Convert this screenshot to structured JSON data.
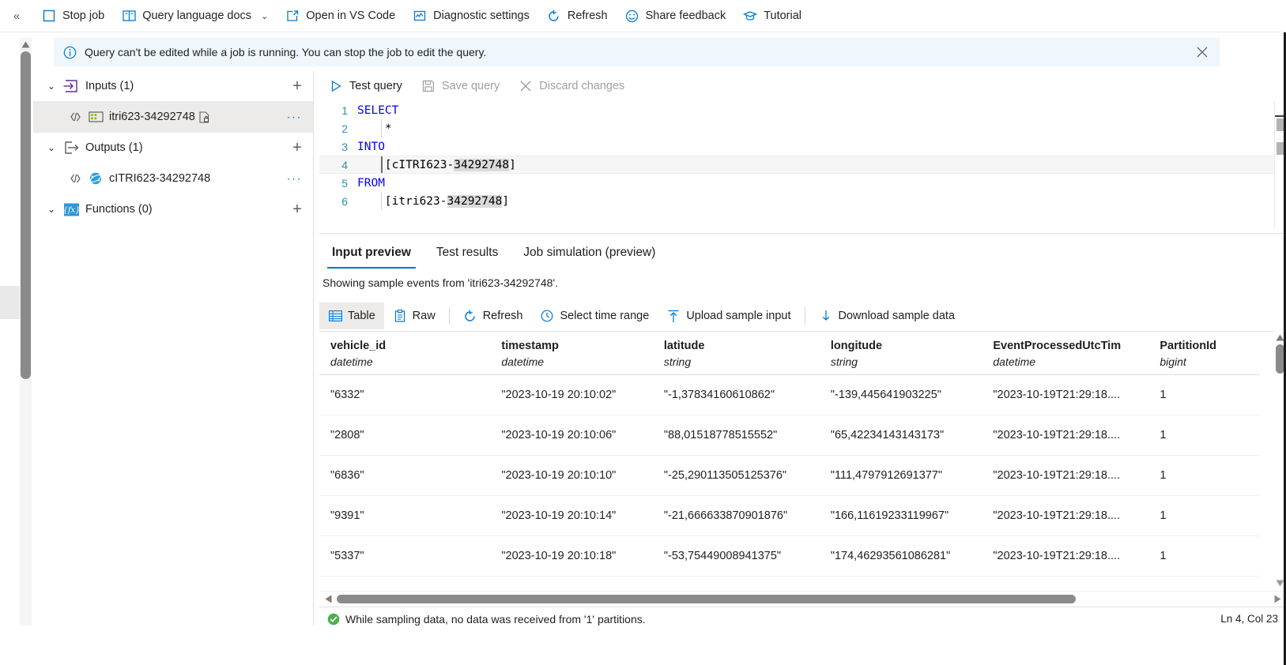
{
  "commandbar": {
    "collapse_glyph": "«",
    "items": [
      {
        "label": "Stop job",
        "icon": "stop-square-icon",
        "has_chevron": false
      },
      {
        "label": "Query language docs",
        "icon": "book-icon",
        "has_chevron": true,
        "chevron": "⌄"
      },
      {
        "label": "Open in VS Code",
        "icon": "open-external-icon",
        "has_chevron": false
      },
      {
        "label": "Diagnostic settings",
        "icon": "chart-monitor-icon",
        "has_chevron": false
      },
      {
        "label": "Refresh",
        "icon": "refresh-icon",
        "has_chevron": false
      },
      {
        "label": "Share feedback",
        "icon": "smiley-icon",
        "has_chevron": false
      },
      {
        "label": "Tutorial",
        "icon": "graduation-cap-icon",
        "has_chevron": false
      }
    ]
  },
  "banner": {
    "icon": "info-circle-icon",
    "message": "Query can't be edited while a job is running. You can stop the job to edit the query.",
    "close_icon": "close-icon"
  },
  "tree": {
    "groups": [
      {
        "label": "Inputs (1)",
        "icon": "input-arrow-icon",
        "chevron": "⌄",
        "add_glyph": "+",
        "children": [
          {
            "label": "itri623-34292748",
            "icon": "event-hub-icon",
            "link_icon": "link-icon",
            "doc_icon": "document-lock-icon",
            "more_glyph": "···",
            "selected": true
          }
        ]
      },
      {
        "label": "Outputs (1)",
        "icon": "output-arrow-icon",
        "chevron": "⌄",
        "add_glyph": "+",
        "children": [
          {
            "label": "cITRI623-34292748",
            "icon": "cosmos-db-icon",
            "link_icon": "link-icon",
            "doc_icon": "",
            "more_glyph": "···",
            "selected": false
          }
        ]
      },
      {
        "label": "Functions (0)",
        "icon": "function-icon",
        "chevron": "⌄",
        "add_glyph": "+",
        "children": []
      }
    ]
  },
  "editor": {
    "toolbar": [
      {
        "label": "Test query",
        "icon": "play-icon",
        "disabled": false
      },
      {
        "label": "Save query",
        "icon": "save-icon",
        "disabled": true
      },
      {
        "label": "Discard changes",
        "icon": "close-x-icon",
        "disabled": true
      }
    ],
    "lines": [
      {
        "no": "1",
        "keyword": "SELECT",
        "rest": "",
        "indent": false,
        "active": false,
        "highlight": ""
      },
      {
        "no": "2",
        "keyword": "",
        "rest": "    *",
        "indent": true,
        "active": false,
        "highlight": ""
      },
      {
        "no": "3",
        "keyword": "INTO",
        "rest": "",
        "indent": false,
        "active": false,
        "highlight": ""
      },
      {
        "no": "4",
        "keyword": "",
        "rest": "    [cITRI623-",
        "indent": true,
        "active": true,
        "highlight": "34292748",
        "tail": "]"
      },
      {
        "no": "5",
        "keyword": "FROM",
        "rest": "",
        "indent": false,
        "active": false,
        "highlight": ""
      },
      {
        "no": "6",
        "keyword": "",
        "rest": "    [itri623-",
        "indent": true,
        "active": false,
        "highlight": "34292748",
        "tail": "]"
      }
    ]
  },
  "results": {
    "tabs": [
      {
        "label": "Input preview",
        "active": true
      },
      {
        "label": "Test results",
        "active": false
      },
      {
        "label": "Job simulation (preview)",
        "active": false
      }
    ],
    "showing_text": "Showing sample events from 'itri623-34292748'.",
    "toolbar": [
      {
        "label": "Table",
        "icon": "table-icon",
        "selected": true
      },
      {
        "label": "Raw",
        "icon": "clipboard-icon",
        "selected": false
      },
      {
        "label": "Refresh",
        "icon": "refresh-icon",
        "selected": false
      },
      {
        "label": "Select time range",
        "icon": "clock-icon",
        "selected": false
      },
      {
        "label": "Upload sample input",
        "icon": "upload-icon",
        "selected": false
      },
      {
        "label": "Download sample data",
        "icon": "download-icon",
        "selected": false
      }
    ],
    "columns": [
      {
        "name": "vehicle_id",
        "type": "datetime"
      },
      {
        "name": "timestamp",
        "type": "datetime"
      },
      {
        "name": "latitude",
        "type": "string"
      },
      {
        "name": "longitude",
        "type": "string"
      },
      {
        "name": "EventProcessedUtcTim",
        "type": "datetime"
      },
      {
        "name": "PartitionId",
        "type": "bigint"
      }
    ],
    "rows": [
      [
        "\"6332\"",
        "\"2023-10-19 20:10:02\"",
        "\"-1,37834160610862\"",
        "\"-139,445641903225\"",
        "\"2023-10-19T21:29:18....",
        "1"
      ],
      [
        "\"2808\"",
        "\"2023-10-19 20:10:06\"",
        "\"88,01518778515552\"",
        "\"65,42234143143173\"",
        "\"2023-10-19T21:29:18....",
        "1"
      ],
      [
        "\"6836\"",
        "\"2023-10-19 20:10:10\"",
        "\"-25,290113505125376\"",
        "\"111,4797912691377\"",
        "\"2023-10-19T21:29:18....",
        "1"
      ],
      [
        "\"9391\"",
        "\"2023-10-19 20:10:14\"",
        "\"-21,666633870901876\"",
        "\"166,11619233119967\"",
        "\"2023-10-19T21:29:18....",
        "1"
      ],
      [
        "\"5337\"",
        "\"2023-10-19 20:10:18\"",
        "\"-53,75449008941375\"",
        "\"174,46293561086281\"",
        "\"2023-10-19T21:29:18....",
        "1"
      ]
    ]
  },
  "statusbar": {
    "icon": "success-check-icon",
    "message": "While sampling data, no data was received from '1' partitions.",
    "position": "Ln 4, Col 23"
  },
  "colors": {
    "accent": "#0078d4",
    "banner_bg": "#eff6fc",
    "keyword": "#0000ff",
    "linenum": "#2b91af",
    "selection": "#dadada",
    "success": "#4caf50"
  }
}
